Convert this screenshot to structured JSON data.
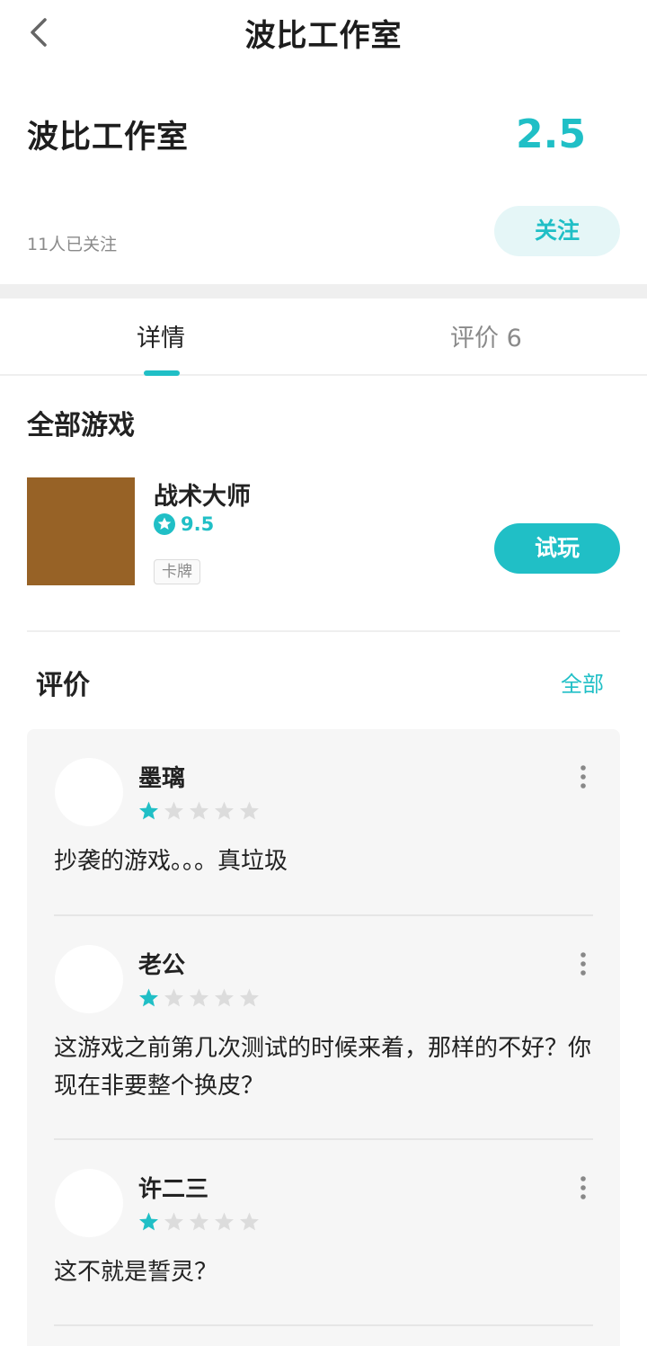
{
  "header": {
    "title": "波比工作室"
  },
  "studio": {
    "name": "波比工作室",
    "score": "2.5",
    "followers": "11人已关注",
    "follow_label": "关注"
  },
  "tabs": [
    {
      "label": "详情",
      "active": true
    },
    {
      "label": "评价 6",
      "active": false
    }
  ],
  "games_section": {
    "title": "全部游戏",
    "games": [
      {
        "name": "战术大师",
        "score": "9.5",
        "tag": "卡牌",
        "button_label": "试玩",
        "thumb_color": "#976226"
      }
    ]
  },
  "reviews_section": {
    "title": "评价",
    "all_label": "全部",
    "reviews": [
      {
        "name": "墨璃",
        "rating": 1,
        "max_rating": 5,
        "text": "抄袭的游戏。。。真垃圾"
      },
      {
        "name": "老公",
        "rating": 1,
        "max_rating": 5,
        "text": "这游戏之前第几次测试的时候来着，那样的不好？你现在非要整个换皮？"
      },
      {
        "name": "许二三",
        "rating": 1,
        "max_rating": 5,
        "text": "这不就是誓灵？"
      }
    ]
  },
  "colors": {
    "accent": "#20bfc6",
    "accent_light": "#e5f6f7",
    "text": "#222222",
    "muted": "#8a8a8a",
    "star_empty": "#dcdcdc"
  }
}
